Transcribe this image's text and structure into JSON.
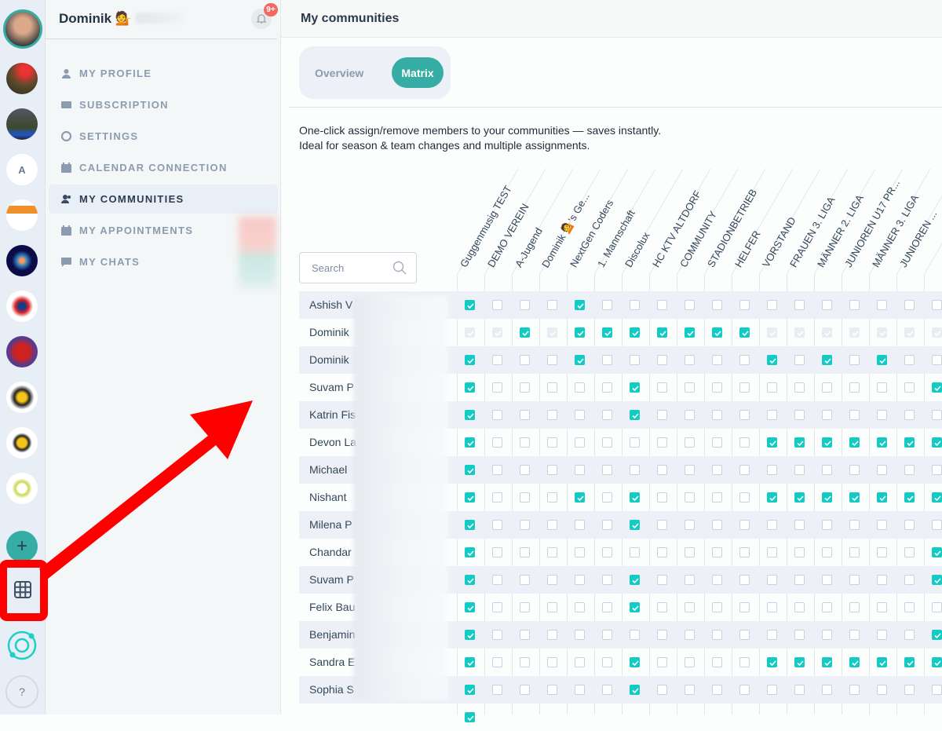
{
  "user": {
    "name": "Dominik 💁",
    "notifications": "9+"
  },
  "rail": {
    "letter_avatar": "A",
    "add_label": "+",
    "help_label": "?"
  },
  "nav": [
    {
      "label": "MY PROFILE",
      "icon": "person-icon"
    },
    {
      "label": "SUBSCRIPTION",
      "icon": "card-icon"
    },
    {
      "label": "SETTINGS",
      "icon": "gear-icon"
    },
    {
      "label": "CALENDAR CONNECTION",
      "icon": "calendar-icon"
    },
    {
      "label": "MY COMMUNITIES",
      "icon": "group-icon",
      "active": true
    },
    {
      "label": "MY APPOINTMENTS",
      "icon": "calendar-icon"
    },
    {
      "label": "MY CHATS",
      "icon": "chat-icon"
    }
  ],
  "page": {
    "title": "My communities",
    "tabs": [
      "Overview",
      "Matrix"
    ],
    "active_tab": "Matrix",
    "desc1": "One-click assign/remove members to your communities — saves instantly.",
    "desc2": "Ideal for season & team changes and multiple assignments.",
    "search_placeholder": "Search"
  },
  "colors": {
    "accent": "#35aca4",
    "check": "#12cbc4",
    "annotation": "#ff0000"
  },
  "columns": [
    "Guggenmusig TEST",
    "DEMO VEREIN",
    "A-Jugend",
    "Dominik 💁's Ge...",
    "NextGen Coders",
    "1. Mannschaft",
    "Discolux",
    "HC KTV ALTDORF",
    "COMMUNITY",
    "STADIONBETRIEB",
    "HELFER",
    "VORSTAND",
    "FRAUEN 3. LIGA",
    "MÄNNER 2. LIGA",
    "JUNIOREN U17 PR...",
    "MÄNNER 3. LIGA",
    "JUNIOREN ..."
  ],
  "members": [
    {
      "name": "Ashish V",
      "states": "100010000000000000"
    },
    {
      "name": "Dominik",
      "states": "dd1d1111111ddddddd"
    },
    {
      "name": "Dominik",
      "states": "100010000001010100"
    },
    {
      "name": "Suvam P",
      "states": "100000100000000001"
    },
    {
      "name": "Katrin Fis",
      "states": "100000100000000000"
    },
    {
      "name": "Devon La",
      "states": "100000000001111111"
    },
    {
      "name": "Michael",
      "states": "100000000000000000"
    },
    {
      "name": "Nishant",
      "states": "100010100001111111"
    },
    {
      "name": "Milena P",
      "states": "100000100000000000"
    },
    {
      "name": "Chandar",
      "states": "100000000000000001"
    },
    {
      "name": "Suvam P",
      "states": "100000100000000001"
    },
    {
      "name": "Felix Bau",
      "states": "100000100000000000"
    },
    {
      "name": "Benjamin",
      "states": "100000000000000001"
    },
    {
      "name": "Sandra E",
      "states": "100000100001111111"
    },
    {
      "name": "Sophia S",
      "states": "100000100000000000"
    }
  ]
}
